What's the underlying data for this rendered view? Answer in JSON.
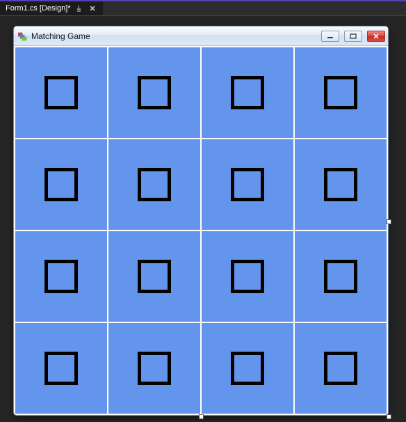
{
  "ide": {
    "tab_label": "Form1.cs [Design]*"
  },
  "form": {
    "title": "Matching Game",
    "grid_rows": 4,
    "grid_cols": 4
  }
}
